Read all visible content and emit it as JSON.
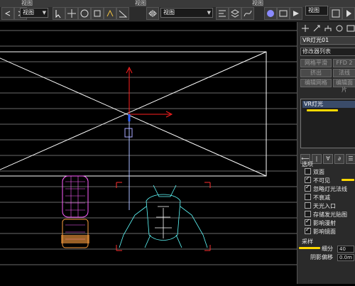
{
  "toolbar": {
    "menu_labels": [
      "视图",
      "视图",
      "视图"
    ],
    "view_dropdown": "视图",
    "view_dropdown2": "视图",
    "icons": [
      "undo-icon",
      "redo-icon",
      "select-icon",
      "move-icon",
      "rotate-icon",
      "scale-icon",
      "snap-icon",
      "angle-snap-icon",
      "mirror-icon",
      "align-icon",
      "layer-icon",
      "curve-icon",
      "material-icon",
      "render-setup-icon",
      "render-icon"
    ]
  },
  "panel": {
    "object_name": "VR灯光01",
    "modifier_list": "修改器列表",
    "modifier_buttons": [
      "网格平滑",
      "FFD 2",
      "挤出",
      "法线",
      "编辑网格",
      "编辑面片"
    ],
    "stack_item": "VR灯光",
    "options_header": "选项",
    "options": [
      {
        "label": "双面",
        "checked": false
      },
      {
        "label": "不可见",
        "checked": true
      },
      {
        "label": "忽略灯光法线",
        "checked": true
      },
      {
        "label": "不衰减",
        "checked": false
      },
      {
        "label": "天光入口",
        "checked": false
      },
      {
        "label": "存储发光贴图",
        "checked": false
      },
      {
        "label": "影响漫射",
        "checked": true
      },
      {
        "label": "影响镜面",
        "checked": true
      }
    ],
    "sampling_header": "采样",
    "subdiv_label": "细分",
    "subdiv_value": "40",
    "shadow_bias_label": "阴影偏移",
    "shadow_bias_value": "0.0m"
  },
  "colors": {
    "highlight": "#ffd800",
    "gizmo_red": "#ff2020",
    "gizmo_blue": "#3060ff",
    "wire_pink": "#ff60ff",
    "wire_cyan": "#60ffff"
  }
}
